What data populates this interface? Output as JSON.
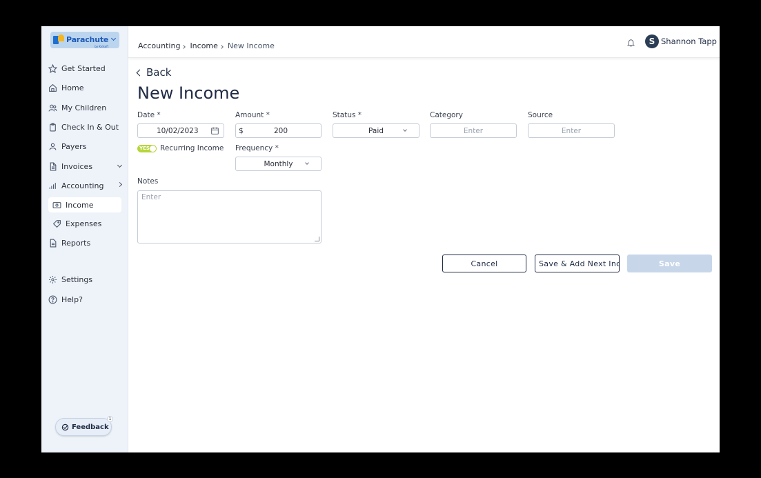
{
  "logo": {
    "name": "Parachute",
    "sub": "by Kidsoft"
  },
  "sidebar": {
    "items": [
      {
        "label": "Get Started"
      },
      {
        "label": "Home"
      },
      {
        "label": "My Children"
      },
      {
        "label": "Check In & Out"
      },
      {
        "label": "Payers"
      },
      {
        "label": "Invoices"
      },
      {
        "label": "Accounting"
      },
      {
        "label": "Income"
      },
      {
        "label": "Expenses"
      },
      {
        "label": "Reports"
      },
      {
        "label": "Settings"
      },
      {
        "label": "Help?"
      }
    ],
    "feedback_label": "Feedback",
    "feedback_badge": "1"
  },
  "header": {
    "breadcrumb": [
      "Accounting",
      "Income",
      "New Income"
    ],
    "user_initial": "S",
    "user_name": "Shannon Tapp"
  },
  "main": {
    "back_label": "Back",
    "title": "New Income",
    "date": {
      "label": "Date *",
      "value": "10/02/2023"
    },
    "amount": {
      "label": "Amount *",
      "prefix": "$",
      "value": "200"
    },
    "status": {
      "label": "Status *",
      "value": "Paid"
    },
    "category": {
      "label": "Category",
      "placeholder": "Enter"
    },
    "source": {
      "label": "Source",
      "placeholder": "Enter"
    },
    "recurring": {
      "toggle_text": "YES",
      "label": "Recurring Income"
    },
    "frequency": {
      "label": "Frequency *",
      "value": "Monthly"
    },
    "notes": {
      "label": "Notes",
      "placeholder": "Enter"
    },
    "buttons": {
      "cancel": "Cancel",
      "save_add_next": "Save & Add Next Income",
      "save": "Save"
    }
  },
  "colors": {
    "sidebar_bg": "#eef3fa",
    "toggle_on": "#b7d63a",
    "primary_disabled": "#c8d6ea",
    "text_dark": "#1f2a44"
  }
}
